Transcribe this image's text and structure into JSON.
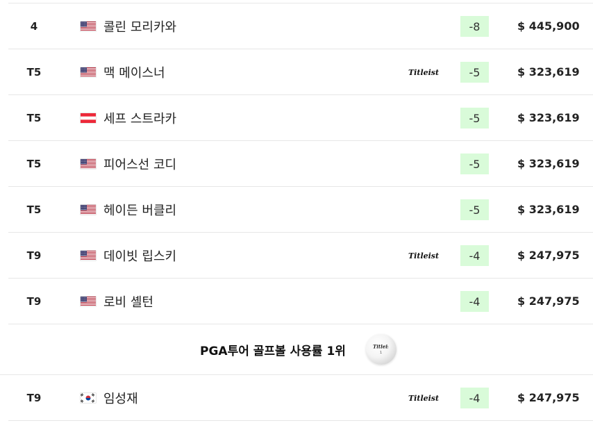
{
  "leaderboard": {
    "rows": [
      {
        "rank": "4",
        "flag": "us-flag",
        "name": "콜린 모리카와",
        "sponsor": "",
        "score": "-8",
        "prize": "$ 445,900"
      },
      {
        "rank": "T5",
        "flag": "us-flag",
        "name": "맥 메이스너",
        "sponsor": "titleist",
        "score": "-5",
        "prize": "$ 323,619"
      },
      {
        "rank": "T5",
        "flag": "at-flag",
        "name": "세프 스트라카",
        "sponsor": "",
        "score": "-5",
        "prize": "$ 323,619"
      },
      {
        "rank": "T5",
        "flag": "us-flag",
        "name": "피어스선 코디",
        "sponsor": "",
        "score": "-5",
        "prize": "$ 323,619"
      },
      {
        "rank": "T5",
        "flag": "us-flag",
        "name": "헤이든 버클리",
        "sponsor": "",
        "score": "-5",
        "prize": "$ 323,619"
      },
      {
        "rank": "T9",
        "flag": "us-flag",
        "name": "데이빗 립스키",
        "sponsor": "titleist",
        "score": "-4",
        "prize": "$ 247,975"
      },
      {
        "rank": "T9",
        "flag": "us-flag",
        "name": "로비 셸턴",
        "sponsor": "",
        "score": "-4",
        "prize": "$ 247,975"
      }
    ],
    "banner": {
      "text": "PGA투어 골프볼 사용률 1위",
      "icon": "golf-ball-icon"
    },
    "after_banner": [
      {
        "rank": "T9",
        "flag": "kr-flag",
        "name": "임성재",
        "sponsor": "titleist",
        "score": "-4",
        "prize": "$ 247,975"
      }
    ]
  },
  "colors": {
    "score_bg": "#d9fbd9",
    "divider": "#e6e6e6",
    "text": "#222222"
  }
}
